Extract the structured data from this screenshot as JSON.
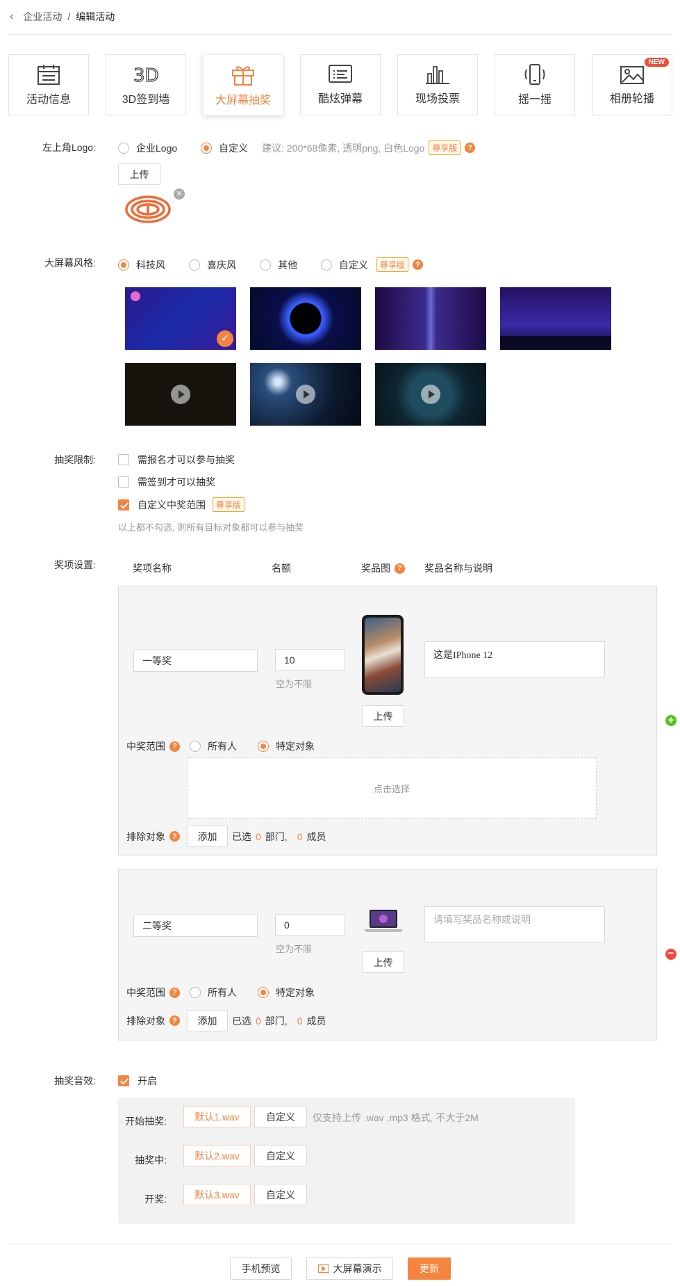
{
  "breadcrumb": {
    "parent": "企业活动",
    "sep": "/",
    "current": "编辑活动"
  },
  "tabs": [
    {
      "label": "活动信息",
      "icon": "calendar-icon"
    },
    {
      "label": "3D签到墙",
      "icon": "3d-icon"
    },
    {
      "label": "大屏幕抽奖",
      "icon": "gift-icon"
    },
    {
      "label": "酷炫弹幕",
      "icon": "danmu-icon"
    },
    {
      "label": "现场投票",
      "icon": "bar-chart-icon"
    },
    {
      "label": "摇一摇",
      "icon": "phone-shake-icon"
    },
    {
      "label": "相册轮播",
      "icon": "photo-icon",
      "badge": "NEW"
    }
  ],
  "logo": {
    "label": "左上角Logo:",
    "opt1": "企业Logo",
    "opt2": "自定义",
    "hint": "建议: 200*68像素, 透明png, 白色Logo",
    "tag": "尊享版",
    "upload": "上传"
  },
  "style": {
    "label": "大屏幕风格:",
    "opts": [
      "科技风",
      "喜庆风",
      "其他",
      "自定义"
    ],
    "tag": "尊享版"
  },
  "limit": {
    "label": "抽奖限制:",
    "opt1": "需报名才可以参与抽奖",
    "opt2": "需签到才可以抽奖",
    "opt3": "自定义中奖范围",
    "tag": "尊享版",
    "note": "以上都不勾选, 则所有目标对象都可以参与抽奖"
  },
  "prizes": {
    "label": "奖项设置:",
    "h_name": "奖项名称",
    "h_count": "名额",
    "h_image": "奖品图",
    "h_desc": "奖品名称与说明",
    "p1": {
      "name": "一等奖",
      "count": "10",
      "count_hint": "空为不限",
      "desc": "这是IPhone 12",
      "upload": "上传",
      "scope": "中奖范围",
      "all": "所有人",
      "specific": "特定对象",
      "picker": "点击选择",
      "exclude": "排除对象",
      "add": "添加",
      "sel1": "已选",
      "dept_n": "0",
      "dept": "部门,",
      "mem_n": "0",
      "mem": "成员"
    },
    "p2": {
      "name": "二等奖",
      "count": "0",
      "count_hint": "空为不限",
      "desc_ph": "请填写奖品名称或说明",
      "upload": "上传",
      "scope": "中奖范围",
      "all": "所有人",
      "specific": "特定对象",
      "exclude": "排除对象",
      "add": "添加",
      "sel1": "已选",
      "dept_n": "0",
      "dept": "部门,",
      "mem_n": "0",
      "mem": "成员"
    }
  },
  "sound": {
    "label": "抽奖音效:",
    "enable": "开启",
    "rows": [
      {
        "label": "开始抽奖:",
        "file": "默认1.wav",
        "custom": "自定义",
        "hint": "仅支持上传 .wav .mp3 格式, 不大于2M"
      },
      {
        "label": "抽奖中:",
        "file": "默认2.wav",
        "custom": "自定义"
      },
      {
        "label": "开奖:",
        "file": "默认3.wav",
        "custom": "自定义"
      }
    ]
  },
  "footer": {
    "preview": "手机预览",
    "demo": "大屏幕演示",
    "update": "更新"
  },
  "colors": {
    "accent": "#f5843f",
    "add": "#52c41a",
    "remove": "#f5483f"
  }
}
